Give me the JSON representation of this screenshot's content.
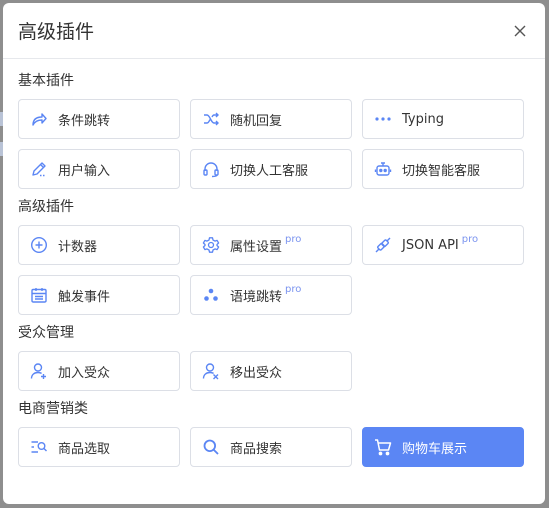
{
  "modal": {
    "title": "高级插件"
  },
  "sections": [
    {
      "title": "基本插件",
      "items": [
        {
          "label": "条件跳转",
          "icon": "share-arrow-icon"
        },
        {
          "label": "随机回复",
          "icon": "shuffle-icon"
        },
        {
          "label": "Typing",
          "icon": "ellipsis-icon"
        },
        {
          "label": "用户输入",
          "icon": "pen-icon"
        },
        {
          "label": "切换人工客服",
          "icon": "headset-icon"
        },
        {
          "label": "切换智能客服",
          "icon": "robot-icon"
        }
      ]
    },
    {
      "title": "高级插件",
      "items": [
        {
          "label": "计数器",
          "icon": "plus-circle-icon"
        },
        {
          "label": "属性设置",
          "icon": "gear-icon",
          "pro": "pro"
        },
        {
          "label": "JSON API",
          "icon": "link-plug-icon",
          "pro": "pro"
        },
        {
          "label": "触发事件",
          "icon": "calendar-icon"
        },
        {
          "label": "语境跳转",
          "icon": "dots-cluster-icon",
          "pro": "pro"
        }
      ]
    },
    {
      "title": "受众管理",
      "items": [
        {
          "label": "加入受众",
          "icon": "user-add-icon"
        },
        {
          "label": "移出受众",
          "icon": "user-remove-icon"
        }
      ]
    },
    {
      "title": "电商营销类",
      "items": [
        {
          "label": "商品选取",
          "icon": "list-search-icon"
        },
        {
          "label": "商品搜索",
          "icon": "search-icon"
        },
        {
          "label": "购物车展示",
          "icon": "cart-icon",
          "active": true
        }
      ]
    }
  ],
  "colors": {
    "accent": "#5b86f4",
    "icon": "#5b86f4",
    "pro": "#7b94ef"
  }
}
